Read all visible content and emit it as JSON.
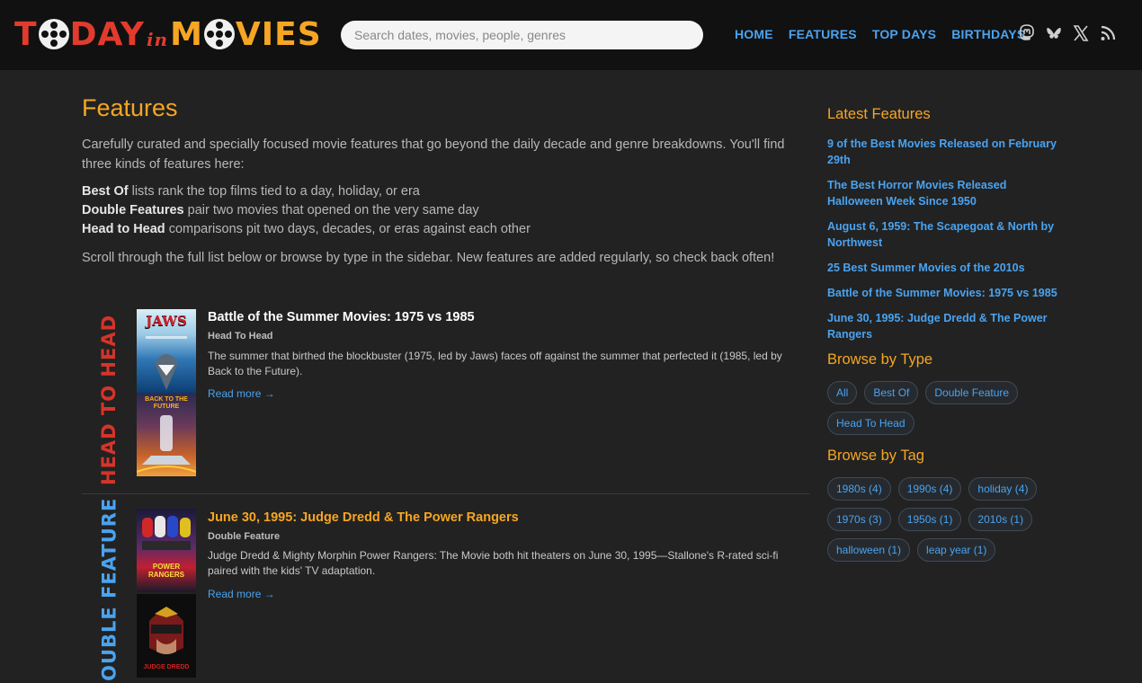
{
  "logo": {
    "part1": "T",
    "part2": "DAY",
    "part3": "in",
    "part4": "M",
    "part5": "VIES"
  },
  "search": {
    "placeholder": "Search dates, movies, people, genres"
  },
  "nav": [
    {
      "label": "HOME"
    },
    {
      "label": "FEATURES"
    },
    {
      "label": "TOP DAYS"
    },
    {
      "label": "BIRTHDAYS"
    }
  ],
  "social_icons": [
    "mastodon-icon",
    "bluesky-icon",
    "x-icon",
    "rss-icon"
  ],
  "main": {
    "title": "Features",
    "intro": "Carefully curated and specially focused movie features that go beyond the daily decade and genre breakdowns. You'll find three kinds of features here:",
    "kinds": [
      {
        "name": "Best Of",
        "text": " lists rank the top films tied to a day, holiday, or era"
      },
      {
        "name": "Double Features",
        "text": " pair two movies that opened on the very same day"
      },
      {
        "name": "Head to Head",
        "text": " comparisons pit two days, decades, or eras against each other"
      }
    ],
    "scroll_note": "Scroll through the full list below or browse by type in the sidebar. New features are added regularly, so check back often!"
  },
  "features": [
    {
      "label": "HEAD TO HEAD",
      "title": "Battle of the Summer Movies: 1975 vs 1985",
      "type": "Head To Head",
      "description": "The summer that birthed the blockbuster (1975, led by Jaws) faces off against the summer that perfected it (1985, led by Back to the Future).",
      "more": "Read more →",
      "poster1_text": "JAWS",
      "poster2_text": "BACK TO THE FUTURE"
    },
    {
      "label": "DOUBLE FEATURE",
      "title": "June 30, 1995: Judge Dredd & The Power Rangers",
      "type": "Double Feature",
      "description": "Judge Dredd & Mighty Morphin Power Rangers: The Movie both hit theaters on June 30, 1995—Stallone's R-rated sci-fi paired with the kids' TV adaptation.",
      "more": "Read more →",
      "poster1_text": "POWER RANGERS",
      "poster2_text": "JUDGE DREDD"
    }
  ],
  "sidebar": {
    "latest_title": "Latest Features",
    "latest": [
      "9 of the Best Movies Released on February 29th",
      "The Best Horror Movies Released Halloween Week Since 1950",
      "August 6, 1959: The Scapegoat & North by Northwest",
      "25 Best Summer Movies of the 2010s",
      "Battle of the Summer Movies: 1975 vs 1985",
      "June 30, 1995: Judge Dredd & The Power Rangers"
    ],
    "type_title": "Browse by Type",
    "types": [
      "All",
      "Best Of",
      "Double Feature",
      "Head To Head"
    ],
    "tag_title": "Browse by Tag",
    "tags": [
      "1980s (4)",
      "1990s (4)",
      "holiday (4)",
      "1970s (3)",
      "1950s (1)",
      "2010s (1)",
      "halloween (1)",
      "leap year (1)"
    ]
  },
  "colors": {
    "accent": "#f6a623",
    "link": "#4aa3f0",
    "red": "#d6342a",
    "bg": "#222222",
    "header": "#111111"
  }
}
